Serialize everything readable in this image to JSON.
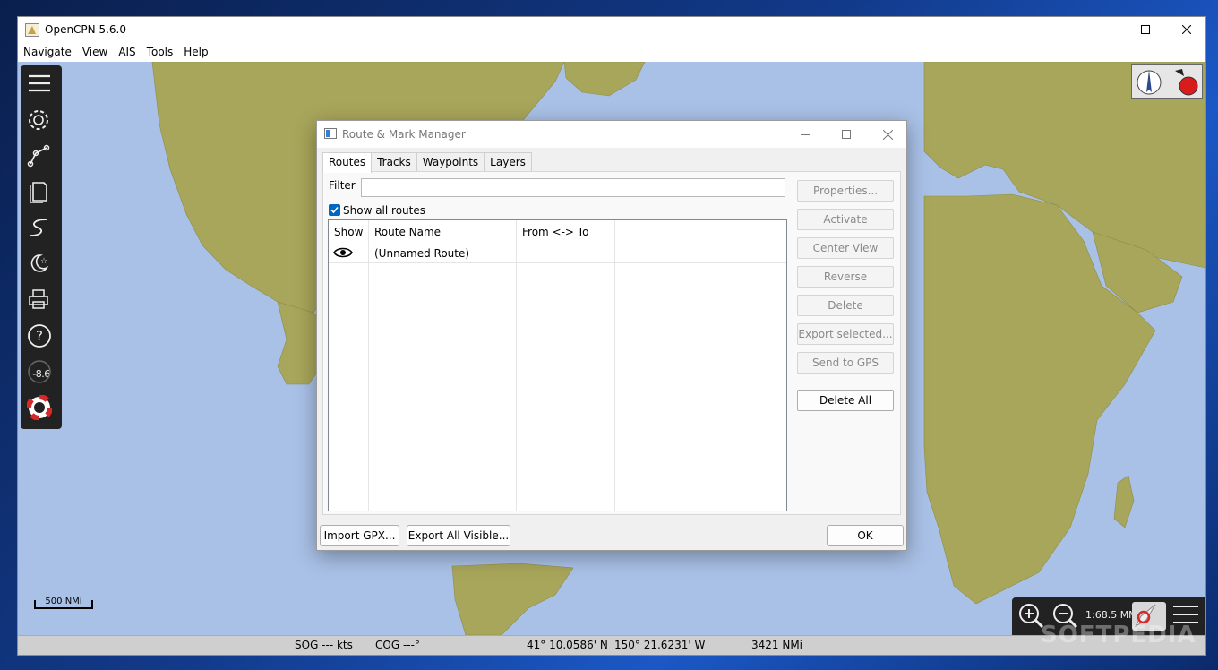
{
  "window": {
    "title": "OpenCPN 5.6.0",
    "controls": {
      "minimize": "minimize-icon",
      "maximize": "maximize-icon",
      "close": "close-icon"
    }
  },
  "menu": [
    "Navigate",
    "View",
    "AIS",
    "Tools",
    "Help"
  ],
  "toolbar": {
    "items": [
      "menu-icon",
      "settings-gear-icon",
      "route-icon",
      "document-icon",
      "track-icon",
      "night-mode-icon",
      "print-icon",
      "help-icon",
      "tide-icon",
      "mob-lifebuoy-icon"
    ],
    "tide_value": "-8.6"
  },
  "scale_bar": {
    "label": "500 NMi"
  },
  "zoom_panel": {
    "scale": "1:68.5 MM"
  },
  "status": {
    "sog": "SOG --- kts",
    "cog": "COG ---°",
    "lat": "41° 10.0586' N",
    "lon": "150° 21.6231' W",
    "distance": "3421 NMi"
  },
  "dialog": {
    "title": "Route & Mark Manager",
    "tabs": [
      "Routes",
      "Tracks",
      "Waypoints",
      "Layers"
    ],
    "active_tab": "Routes",
    "filter_label": "Filter",
    "filter_value": "",
    "show_all_label": "Show all routes",
    "show_all_checked": true,
    "columns": [
      "Show",
      "Route Name",
      "From <-> To"
    ],
    "rows": [
      {
        "show": "eye-icon",
        "name": "(Unnamed Route)",
        "from_to": ""
      }
    ],
    "side_buttons": [
      "Properties...",
      "Activate",
      "Center View",
      "Reverse",
      "Delete",
      "Export selected...",
      "Send to GPS"
    ],
    "delete_all": "Delete All",
    "import_gpx": "Import GPX...",
    "export_visible": "Export All Visible...",
    "ok": "OK"
  },
  "colors": {
    "sea": "#a9c1e7",
    "land": "#a8a65a",
    "toolbar": "#222222",
    "accent": "#0067c0"
  },
  "watermark": "SOFTPEDIA"
}
